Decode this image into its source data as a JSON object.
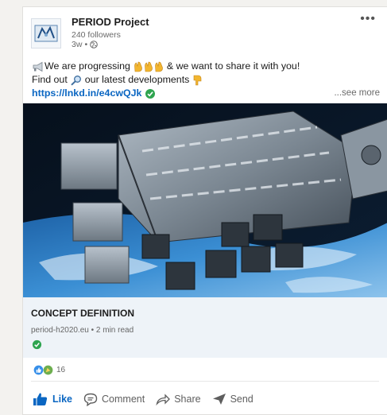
{
  "post": {
    "author_name": "PERIOD Project",
    "followers": "240 followers",
    "time": "3w",
    "time_sep": "•",
    "text_line1_a": "We are progressing",
    "text_line1_b": "& we want to share it with you!",
    "text_line2_a": "Find out",
    "text_line2_b": "our latest developments",
    "link": "https://lnkd.in/e4cwQJk",
    "see_more": "...see more",
    "more_menu": "•••"
  },
  "article": {
    "title": "CONCEPT DEFINITION",
    "meta": "period-h2020.eu • 2 min read"
  },
  "reactions": {
    "count": "16"
  },
  "actions": {
    "like": "Like",
    "comment": "Comment",
    "share": "Share",
    "send": "Send"
  },
  "colors": {
    "link": "#0a66c2",
    "verified": "#2ea44f",
    "article_bg": "#eef3f8"
  }
}
